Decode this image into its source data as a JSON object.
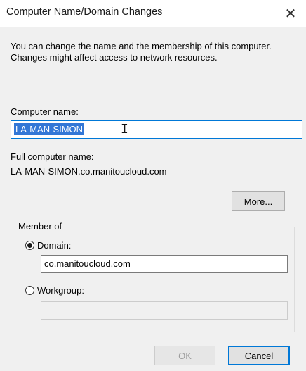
{
  "dialog": {
    "title": "Computer Name/Domain Changes",
    "close_glyph": "✕",
    "description": "You can change the name and the membership of this computer. Changes might affect access to network resources."
  },
  "computer_name": {
    "label": "Computer name:",
    "value": "LA-MAN-SIMON"
  },
  "full_name": {
    "label": "Full computer name:",
    "value": "LA-MAN-SIMON.co.manitoucloud.com"
  },
  "more_button": {
    "label": "More..."
  },
  "member_of": {
    "label": "Member of",
    "domain": {
      "label": "Domain:",
      "value": "co.manitoucloud.com",
      "selected": true
    },
    "workgroup": {
      "label": "Workgroup:",
      "value": "",
      "selected": false
    }
  },
  "buttons": {
    "ok": "OK",
    "cancel": "Cancel"
  },
  "colors": {
    "selection": "#3377d6",
    "focus_border": "#0078d7"
  }
}
